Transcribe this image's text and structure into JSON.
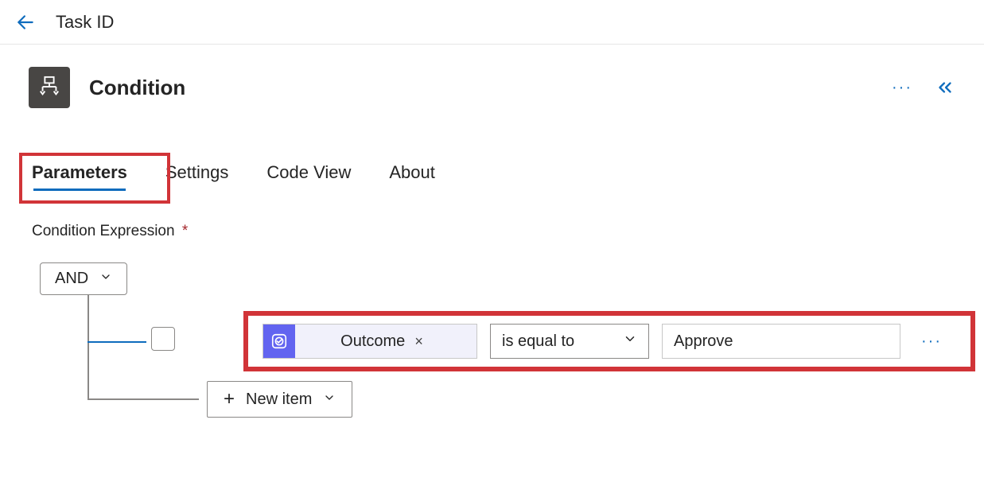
{
  "topbar": {
    "title": "Task ID"
  },
  "header": {
    "node_title": "Condition"
  },
  "tabs": {
    "parameters": "Parameters",
    "settings": "Settings",
    "codeview": "Code View",
    "about": "About",
    "active": "parameters"
  },
  "section": {
    "condition_expression_label": "Condition Expression",
    "required_mark": "*"
  },
  "condition": {
    "logic_operator": "AND",
    "row": {
      "field_name": "Outcome",
      "field_remove": "×",
      "operator": "is equal to",
      "value": "Approve"
    },
    "new_item_label": "New item"
  },
  "icons": {
    "back": "arrow-left",
    "node": "condition",
    "more": "···",
    "collapse": "chevron-double-left",
    "chevron_down": "chevron-down",
    "plus": "+"
  },
  "colors": {
    "accent": "#0f6cbd",
    "highlight": "#d13438",
    "token_bg": "#f1f1fb",
    "token_icon": "#6264f0"
  }
}
